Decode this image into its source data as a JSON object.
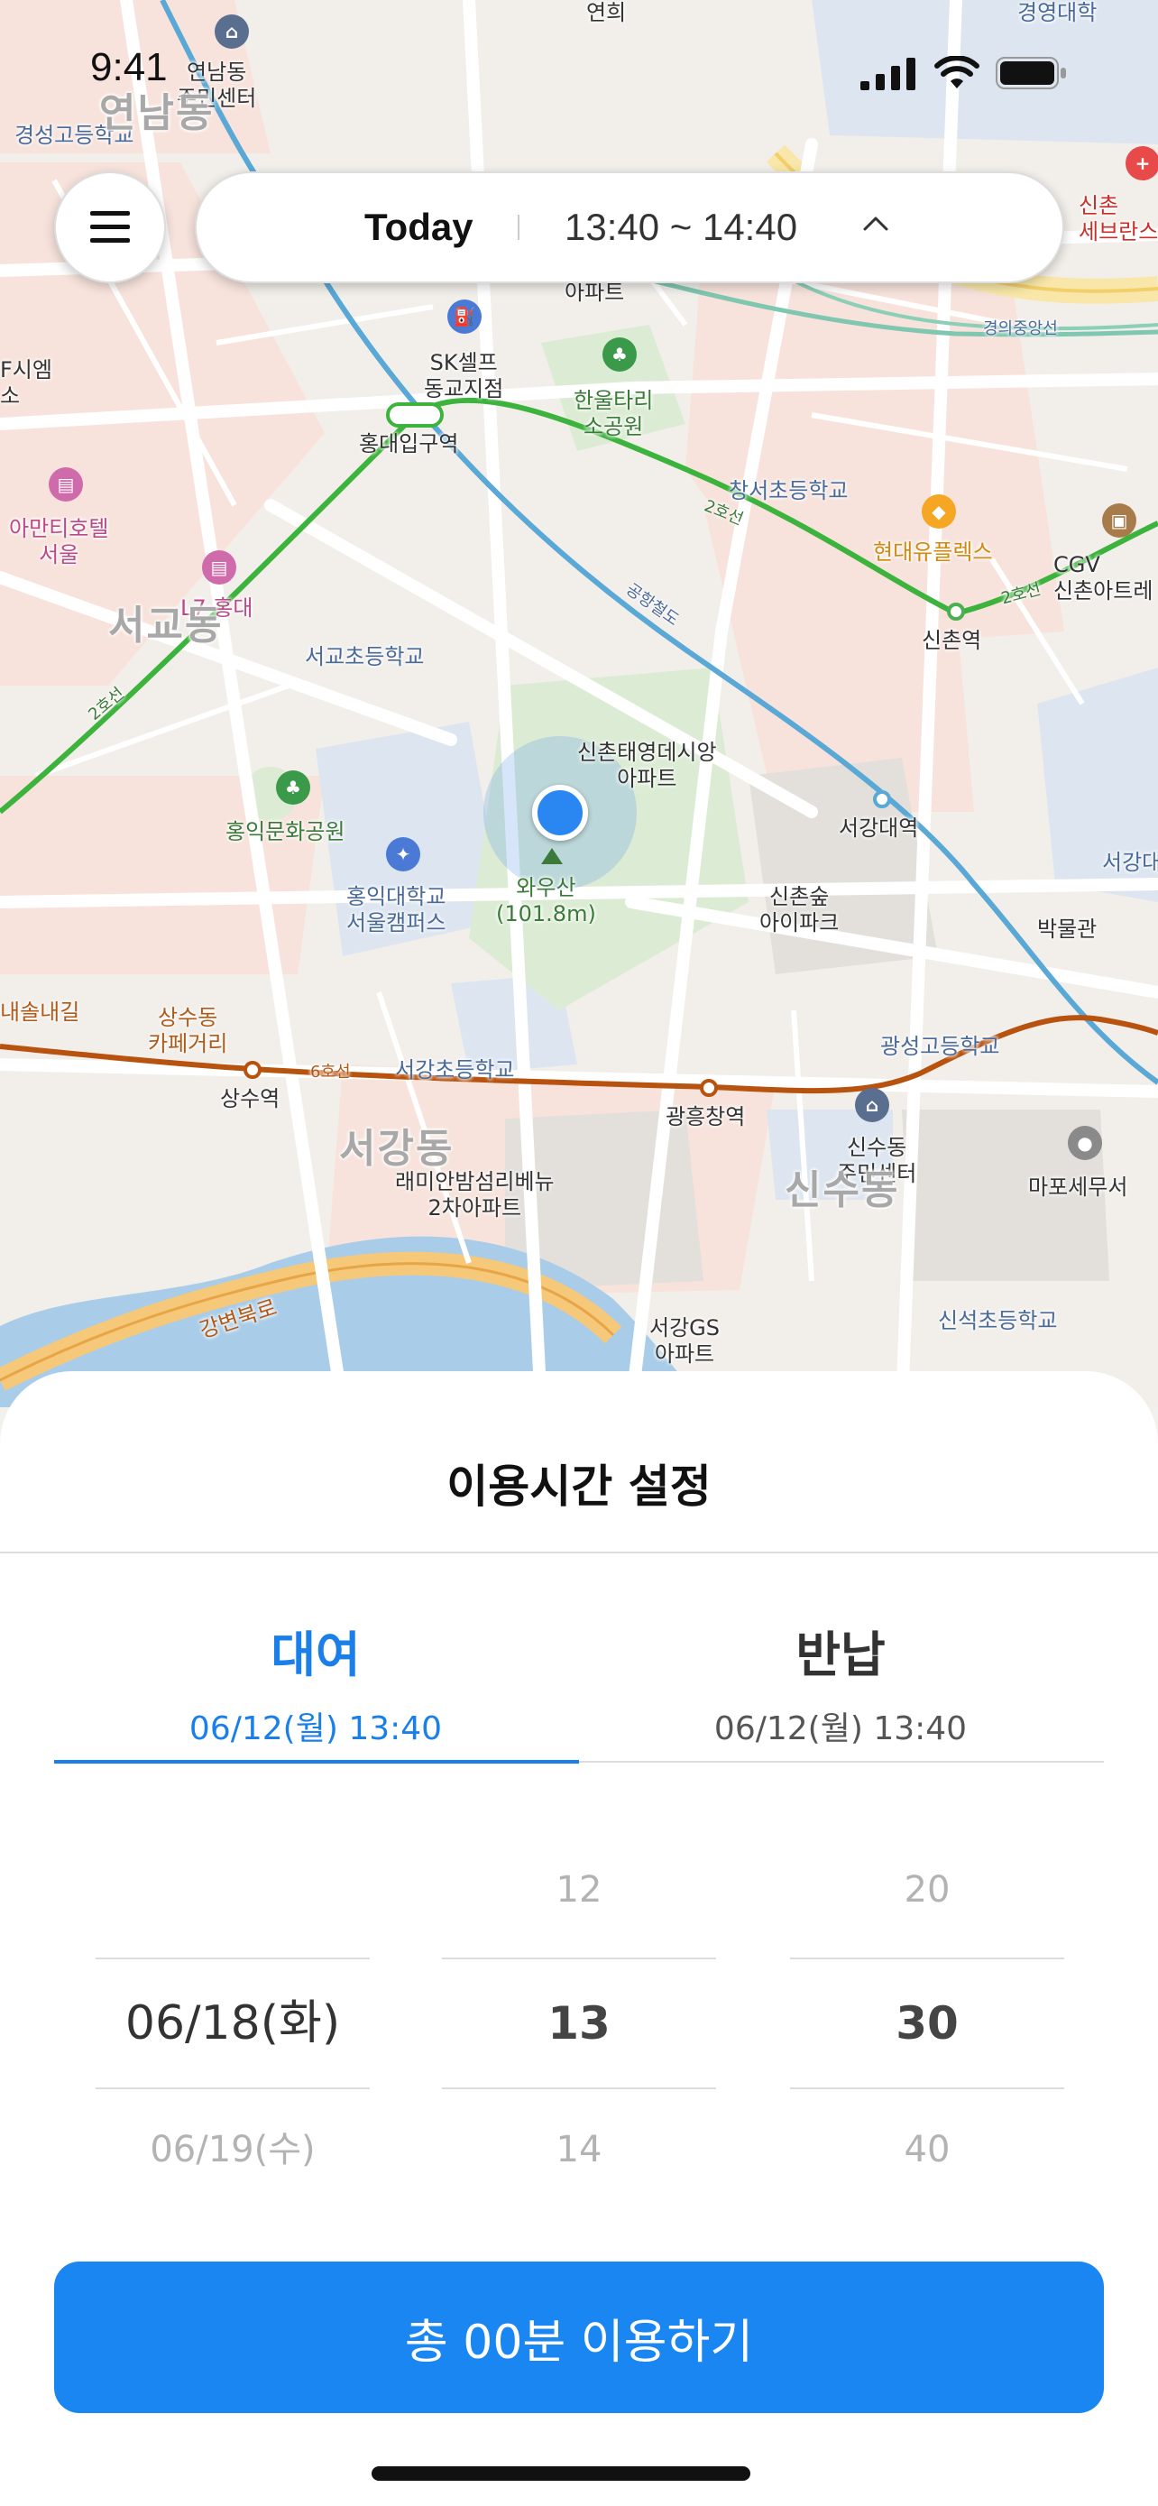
{
  "status_bar": {
    "time": "9:41"
  },
  "top_bar": {
    "today_label": "Today",
    "time_range": "13:40 ~ 14:40"
  },
  "map": {
    "labels": {
      "yeonnam_community": "연남동\n주민센터",
      "gyeongseong_high": "경성고등학교",
      "yeonnam_dong": "연남동",
      "yeonhui": "연희",
      "gyeongyeong_univ": "경영대학",
      "sinchon_severance": "신촌\n세브란스",
      "sk_gas": "SK셀프\n동교지점",
      "hanultari_park": "한울타리\n소공원",
      "hongik_station": "홍대입구역",
      "apartment_top": "아파트",
      "changseo_elem": "창서초등학교",
      "hyundai_uplex": "현대유플렉스",
      "cgv": "CGV\n신촌아트레",
      "amanti_hotel": "아만티호텔\n서울",
      "l7_hongdae": "L7 홍대",
      "seogyo_dong": "서교동",
      "seogyo_elem": "서교초등학교",
      "sinchon_station": "신촌역",
      "sinchon_taeyoung": "신촌태영데시앙\n아파트",
      "hongmun_park": "홍익문화공원",
      "hongik_univ": "홍익대학교\n서울캠퍼스",
      "wausan": "와우산\n(101.8m)",
      "sogang_station": "서강대역",
      "sogang_univ_edge": "서강대",
      "sinchon_forest": "신촌숲\n아이파크",
      "museum": "박물관",
      "gwangseong_high": "광성고등학교",
      "sangsu_cafe": "상수동\n카페거리",
      "sangsu_station": "상수역",
      "seogang_elem": "서강초등학교",
      "gwangheungchang_station": "광흥창역",
      "sinsu_community": "신수동\n주민센터",
      "mapo_tax": "마포세무서",
      "seogang_dong": "서강동",
      "sinsu_dong": "신수동",
      "raemian": "래미안밤섬리베뉴\n2차아파트",
      "gangbyeon_road": "강변북로",
      "seogang_gs": "서강GS\n아파트",
      "sinseok_elem": "신석초등학교",
      "edge_sinsi": "F시엠\n소",
      "edge_sol": "내솔내길",
      "line2": "2호선",
      "line6": "6호선",
      "gyeongui": "경의중앙선",
      "gonghang": "공항철도"
    }
  },
  "sheet": {
    "title": "이용시간 설정",
    "tabs": {
      "rent": {
        "label": "대여",
        "datetime": "06/12(월) 13:40",
        "active": true
      },
      "return": {
        "label": "반납",
        "datetime": "06/12(월) 13:40",
        "active": false
      }
    },
    "picker": {
      "date": {
        "prev": "",
        "current": "06/18(화)",
        "next": "06/19(수)"
      },
      "hour": {
        "prev": "12",
        "current": "13",
        "next": "14"
      },
      "minute": {
        "prev": "20",
        "current": "30",
        "next": "40"
      }
    },
    "cta_label": "총 00분 이용하기"
  },
  "colors": {
    "accent": "#1a7fe8",
    "cta": "#1a86f2",
    "line2": "#3cb33c",
    "line6": "#b8530f",
    "airport_rail": "#5aa8d6"
  }
}
